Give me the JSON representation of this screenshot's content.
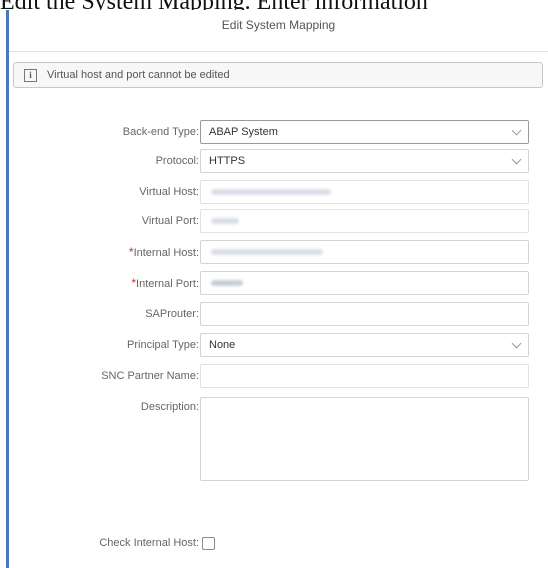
{
  "caption": "Edit the System Mapping. Enter information",
  "dialog": {
    "title": "Edit System Mapping",
    "info_message": "Virtual host and port cannot be edited",
    "info_icon": "info-icon"
  },
  "form": {
    "backend_type": {
      "label": "Back-end Type:",
      "value": "ABAP System"
    },
    "protocol": {
      "label": "Protocol:",
      "value": "HTTPS"
    },
    "virtual_host": {
      "label": "Virtual Host:"
    },
    "virtual_port": {
      "label": "Virtual Port:"
    },
    "internal_host": {
      "label": "Internal Host:",
      "required_mark": "*"
    },
    "internal_port": {
      "label": "Internal Port:",
      "required_mark": "*"
    },
    "saprouter": {
      "label": "SAProuter:",
      "value": ""
    },
    "principal_type": {
      "label": "Principal Type:",
      "value": "None"
    },
    "snc_partner_name": {
      "label": "SNC Partner Name:",
      "value": ""
    },
    "description": {
      "label": "Description:",
      "value": ""
    },
    "check_internal_host": {
      "label": "Check Internal Host:",
      "checked": false
    }
  },
  "colors": {
    "required": "#c0392b",
    "dialog_border": "#4a78b8",
    "redacted": "#d4d9e4"
  }
}
